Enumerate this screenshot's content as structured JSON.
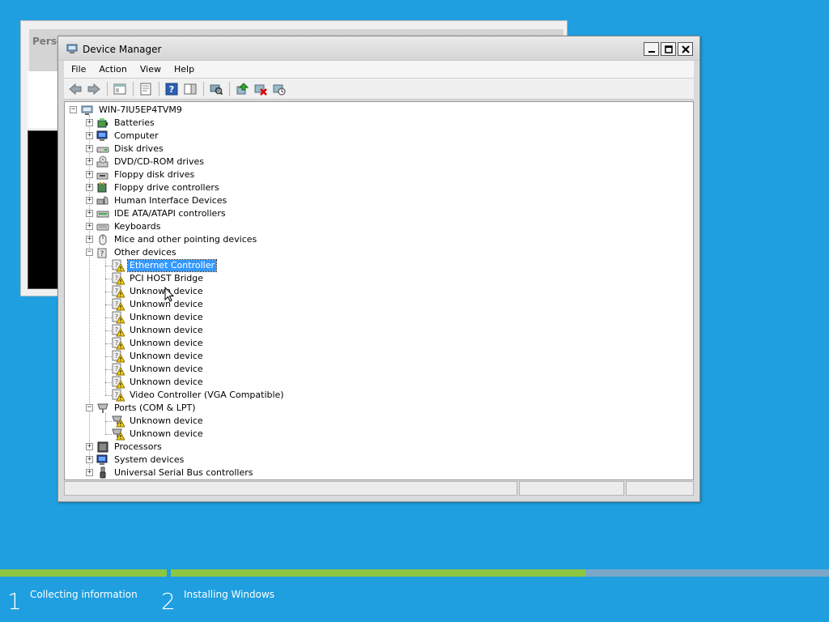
{
  "background_window": {
    "title": "Perso"
  },
  "window": {
    "title": "Device Manager",
    "controls": {
      "minimize": "_",
      "maximize": "□",
      "close": "✕"
    }
  },
  "menu": [
    "File",
    "Action",
    "View",
    "Help"
  ],
  "toolbar_icons": [
    "back-arrow-icon",
    "forward-arrow-icon",
    "show-hide-tree-icon",
    "properties-icon",
    "help-icon",
    "action-pane-icon",
    "scan-hardware-icon",
    "update-driver-icon",
    "uninstall-icon",
    "disable-device-icon"
  ],
  "tree": {
    "root": "WIN-7IU5EP4TVM9",
    "categories": [
      {
        "label": "Batteries",
        "icon": "battery-icon",
        "expanded": false
      },
      {
        "label": "Computer",
        "icon": "computer-icon",
        "expanded": false
      },
      {
        "label": "Disk drives",
        "icon": "disk-drive-icon",
        "expanded": false
      },
      {
        "label": "DVD/CD-ROM drives",
        "icon": "dvd-drive-icon",
        "expanded": false
      },
      {
        "label": "Floppy disk drives",
        "icon": "floppy-drive-icon",
        "expanded": false
      },
      {
        "label": "Floppy drive controllers",
        "icon": "floppy-controller-icon",
        "expanded": false
      },
      {
        "label": "Human Interface Devices",
        "icon": "hid-icon",
        "expanded": false
      },
      {
        "label": "IDE ATA/ATAPI controllers",
        "icon": "ide-controller-icon",
        "expanded": false
      },
      {
        "label": "Keyboards",
        "icon": "keyboard-icon",
        "expanded": false
      },
      {
        "label": "Mice and other pointing devices",
        "icon": "mouse-icon",
        "expanded": false
      },
      {
        "label": "Other devices",
        "icon": "other-devices-icon",
        "expanded": true,
        "children": [
          {
            "label": "Ethernet Controller",
            "icon": "warning-device-icon",
            "selected": true
          },
          {
            "label": "PCI HOST Bridge",
            "icon": "warning-device-icon"
          },
          {
            "label": "Unknown device",
            "icon": "warning-device-icon"
          },
          {
            "label": "Unknown device",
            "icon": "warning-device-icon"
          },
          {
            "label": "Unknown device",
            "icon": "warning-device-icon"
          },
          {
            "label": "Unknown device",
            "icon": "warning-device-icon"
          },
          {
            "label": "Unknown device",
            "icon": "warning-device-icon"
          },
          {
            "label": "Unknown device",
            "icon": "warning-device-icon"
          },
          {
            "label": "Unknown device",
            "icon": "warning-device-icon"
          },
          {
            "label": "Unknown device",
            "icon": "warning-device-icon"
          },
          {
            "label": "Video Controller (VGA Compatible)",
            "icon": "warning-device-icon"
          }
        ]
      },
      {
        "label": "Ports (COM & LPT)",
        "icon": "port-icon",
        "expanded": true,
        "children": [
          {
            "label": "Unknown device",
            "icon": "warning-port-icon"
          },
          {
            "label": "Unknown device",
            "icon": "warning-port-icon"
          }
        ]
      },
      {
        "label": "Processors",
        "icon": "processor-icon",
        "expanded": false
      },
      {
        "label": "System devices",
        "icon": "system-devices-icon",
        "expanded": false
      },
      {
        "label": "Universal Serial Bus controllers",
        "icon": "usb-icon",
        "expanded": false
      }
    ]
  },
  "setup_progress": {
    "step1_fraction": 1.0,
    "step2_fraction": 0.63,
    "colors": {
      "done": "#8dc63f",
      "pending": "#7aa7c7"
    }
  },
  "setup_steps": [
    {
      "number": "1",
      "label": "Collecting information"
    },
    {
      "number": "2",
      "label": "Installing Windows"
    }
  ]
}
